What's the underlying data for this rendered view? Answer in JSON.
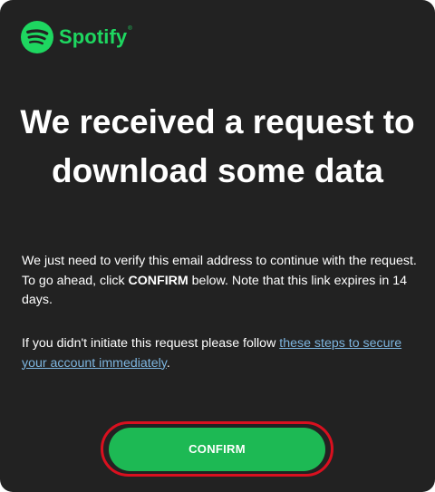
{
  "brand": {
    "name": "Spotify",
    "trademark": "®",
    "color": "#1ed760",
    "icon": "spotify-logo-icon"
  },
  "email": {
    "headline": "We received a request to download some data",
    "body1_part1": "We just need to verify this email address to continue with the request. To go ahead, click ",
    "body1_bold": "CONFIRM",
    "body1_part2": " below. Note that this link expires in 14 days.",
    "body2_part1": "If you didn't initiate this request please follow ",
    "body2_link": "these steps to secure your account immediately",
    "body2_part2": ".",
    "confirm_label": "CONFIRM"
  },
  "colors": {
    "background": "#222222",
    "button": "#1db954",
    "highlight_ring": "#d9101f",
    "link": "#7db5df"
  }
}
